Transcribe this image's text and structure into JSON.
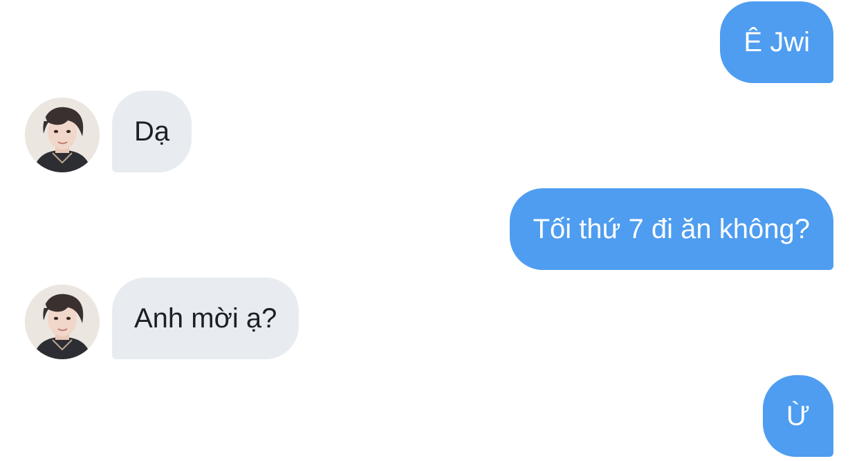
{
  "conversation": {
    "messages": [
      {
        "direction": "outgoing",
        "text": "Ê Jwi"
      },
      {
        "direction": "incoming",
        "text": "Dạ",
        "avatar_icon": "contact-avatar"
      },
      {
        "direction": "outgoing",
        "text": "Tối thứ 7 đi ăn không?"
      },
      {
        "direction": "incoming",
        "text": "Anh mời ạ?",
        "avatar_icon": "contact-avatar"
      },
      {
        "direction": "outgoing",
        "text": "Ừ"
      }
    ]
  },
  "colors": {
    "outgoing_bubble": "#4e9df0",
    "incoming_bubble": "#e8ecf1",
    "outgoing_text": "#ffffff",
    "incoming_text": "#1b2024",
    "background": "#ffffff"
  }
}
